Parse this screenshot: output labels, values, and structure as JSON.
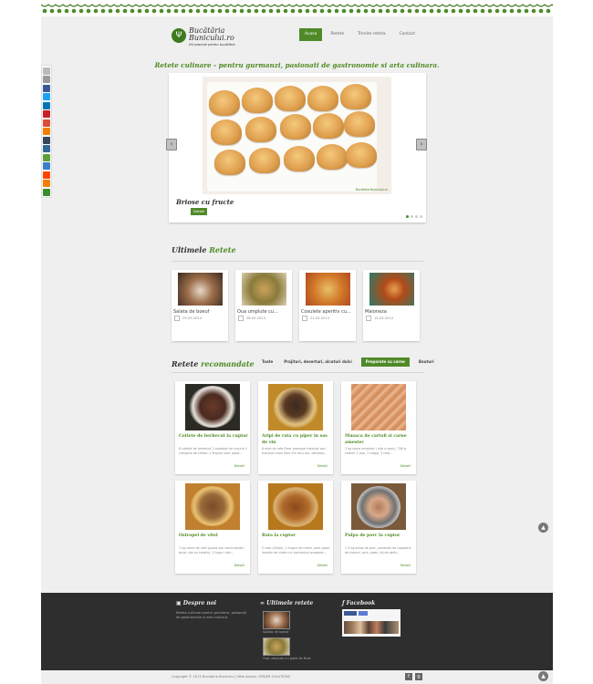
{
  "site": {
    "logo_title": "Bucătăria Bunicului.ro",
    "logo_tagline": "Ori pasiune pentru bucătăria"
  },
  "nav": [
    "Acasa",
    "Retete",
    "Trimite reteta",
    "Contact"
  ],
  "tagline": "Retete culinare - pentru gurmanzi, pasionati de gastronomie si arta culinara.",
  "slider": {
    "caption": "Briose cu fructe",
    "button": "Detalii",
    "watermark": "Bucătăria Bunicului.ro"
  },
  "latest": {
    "title_1": "Ultimele",
    "title_2": "Retete",
    "items": [
      {
        "name": "Salata de boeuf",
        "date": "29-03-2014"
      },
      {
        "name": "Oua umplute cu...",
        "date": "28-03-2014"
      },
      {
        "name": "Cosulete aperitiv cu...",
        "date": "21-03-2014"
      },
      {
        "name": "Maioneza",
        "date": "15-03-2014"
      }
    ]
  },
  "recommended": {
    "title_1": "Retete",
    "title_2": "recomandate",
    "filters": [
      "Toate",
      "Prajituri, deserturi, alcaturi dulci",
      "Preparate cu carne",
      "Bauturi"
    ],
    "active_filter": 2,
    "more_label": "Detalii",
    "items": [
      {
        "name": "Cotlete de berbecut la cuptor",
        "desc": "8 cotlete de berbecut 2 capatani de usturoi 4 crengute de cimbru 1 lingura sare, piper..."
      },
      {
        "name": "Aripi de rata cu piper in sos de vin",
        "desc": "6 aripi de rata Piper proaspat macinat sau macinat mare Sare Vin rosu sec, demisec..."
      },
      {
        "name": "Musaca de cartofi si carne amestec",
        "desc": "1 kg carne amestec ( vita si porc), 700 g cartofi, 2 oua, 1 ceapa, 3 rosii..."
      },
      {
        "name": "Ostropel de vitel",
        "desc": "1 kg carne de vitel (pulpa sau carne pentru tocat, dar nu tocata), 2 linguri ulei..."
      },
      {
        "name": "Rata la cuptor",
        "desc": "O rata (2kilos), 2 linguri de miere, sare, piper, lamaile de cimbru si rozmarinul proaspat..."
      },
      {
        "name": "Pulpa de porc la cuptor",
        "desc": "1.5 kg pulpa de porc, jumatate de capatana de usturoi, sare, piper, foi de dafin..."
      }
    ]
  },
  "footer": {
    "about_title": "Despre noi",
    "about_text": "Retete culinare pentru gurmanzi, pasionati de gastronomie si arta culinara.",
    "latest_title": "Ultimele retete",
    "latest_items": [
      "Salata de boeuf",
      "Oua umplute cu pate de ficat"
    ],
    "facebook_title": "Facebook",
    "copyright": "Copyright © 2013 Bucataria Bunicului | Web design: SPIDER SOLUTIONS"
  },
  "colors": {
    "brand_green": "#4f8a28",
    "footer_bg": "#2e2e2e"
  }
}
